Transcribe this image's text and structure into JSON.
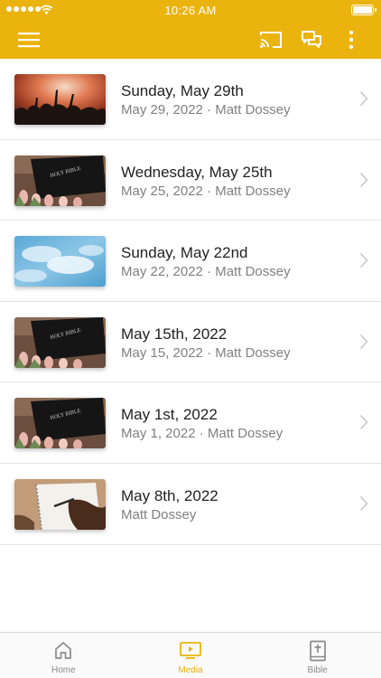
{
  "status_bar": {
    "time": "10:26 AM"
  },
  "app_bar": {
    "menu_icon": "hamburger-menu-icon",
    "cast_icon": "cast-icon",
    "chat_icon": "chat-bubbles-icon",
    "more_icon": "more-vertical-icon"
  },
  "colors": {
    "brand": "#ebb30e",
    "title_text": "#222222",
    "subtitle_text": "#808080",
    "divider": "#e3e3e3"
  },
  "media_items": [
    {
      "title": "Sunday, May 29th",
      "subtitle": "May 29, 2022 · Matt Dossey",
      "thumbnail": "worship-concert-image"
    },
    {
      "title": "Wednesday, May 25th",
      "subtitle": "May 25, 2022 · Matt Dossey",
      "thumbnail": "holy-bible-tulips-image"
    },
    {
      "title": "Sunday, May 22nd",
      "subtitle": "May 22, 2022 · Matt Dossey",
      "thumbnail": "blue-sky-clouds-image"
    },
    {
      "title": "May 15th, 2022",
      "subtitle": "May 15, 2022 · Matt Dossey",
      "thumbnail": "holy-bible-tulips-image"
    },
    {
      "title": "May 1st, 2022",
      "subtitle": "May 1, 2022 · Matt Dossey",
      "thumbnail": "holy-bible-tulips-image"
    },
    {
      "title": "May 8th, 2022",
      "subtitle": "Matt Dossey",
      "thumbnail": "writing-notebook-image"
    }
  ],
  "tabs": [
    {
      "label": "Home",
      "icon": "home-icon",
      "active": false
    },
    {
      "label": "Media",
      "icon": "tv-play-icon",
      "active": true
    },
    {
      "label": "Bible",
      "icon": "bible-cross-icon",
      "active": false
    }
  ]
}
